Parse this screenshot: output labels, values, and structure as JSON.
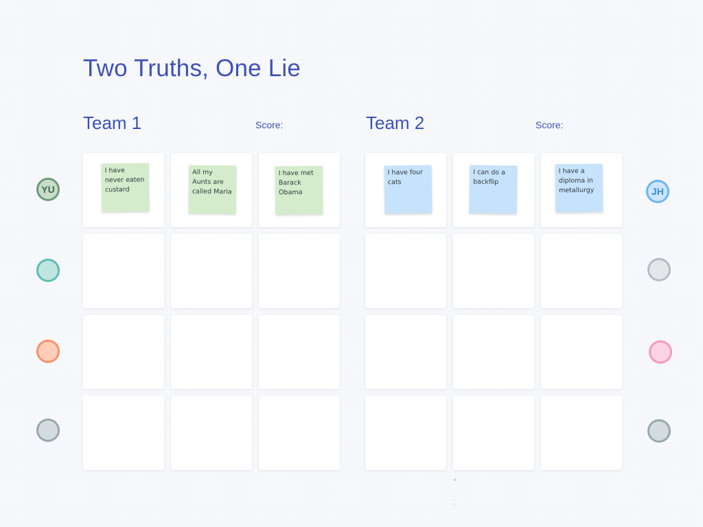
{
  "board": {
    "title": "Two Truths, One Lie"
  },
  "teams": [
    {
      "name": "Team 1",
      "score_label": "Score:",
      "notes": [
        {
          "text": "I have never eaten custard",
          "color": "#d4eccb"
        },
        {
          "text": "All my Aunts are called Maria",
          "color": "#d4eccb"
        },
        {
          "text": "I have met Barack Obama",
          "color": "#d4eccb"
        }
      ]
    },
    {
      "name": "Team 2",
      "score_label": "Score:",
      "notes": [
        {
          "text": "I have four cats",
          "color": "#c6e3fb"
        },
        {
          "text": "I can do a backflip",
          "color": "#c6e3fb"
        },
        {
          "text": "I have a diploma in metallurgy",
          "color": "#c6e3fb"
        }
      ]
    }
  ],
  "participants": {
    "left": [
      {
        "initials": "YU",
        "fill": "#c7ddca",
        "border": "#6f9a78",
        "text_color": "#3f6b48"
      },
      {
        "initials": "",
        "fill": "#bfe5e1",
        "border": "#5dbdb2",
        "text_color": "#2f7d74"
      },
      {
        "initials": "",
        "fill": "#ffcdb8",
        "border": "#f7916a",
        "text_color": "#b65a35"
      },
      {
        "initials": "",
        "fill": "#d5dcdf",
        "border": "#97a8ad",
        "text_color": "#5c6b70"
      }
    ],
    "right": [
      {
        "initials": "JH",
        "fill": "#cbe6fb",
        "border": "#6db6f0",
        "text_color": "#3a8fd6"
      },
      {
        "initials": "",
        "fill": "#e4e6e9",
        "border": "#b6bcc2",
        "text_color": "#6b7278"
      },
      {
        "initials": "",
        "fill": "#fdd2e3",
        "border": "#f29bbd",
        "text_color": "#c0577f"
      },
      {
        "initials": "",
        "fill": "#d5dcdf",
        "border": "#97a8ad",
        "text_color": "#5c6b70"
      }
    ]
  },
  "theme": {
    "accent": "#3f51b5",
    "canvas": "#f6f8fb",
    "cell": "#ffffff"
  }
}
